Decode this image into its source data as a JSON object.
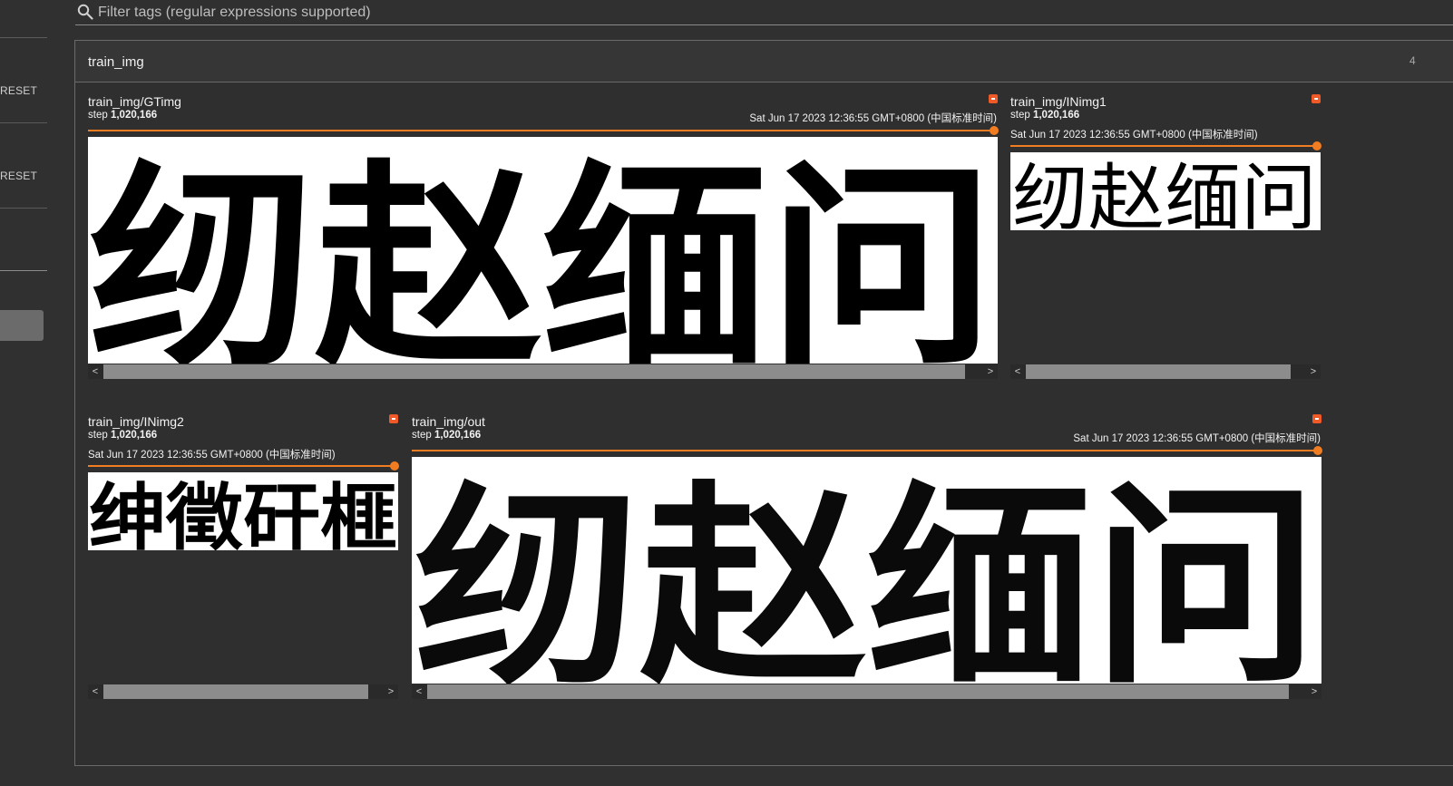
{
  "sidebar": {
    "reset_labels": [
      "RESET",
      "RESET"
    ]
  },
  "filter": {
    "placeholder": "Filter tags (regular expressions supported)",
    "icon": "search-icon"
  },
  "group": {
    "title": "train_img",
    "count": "4"
  },
  "cards": [
    {
      "title": "train_img/GTimg",
      "step_label": "step",
      "step_value": "1,020,166",
      "timestamp": "Sat Jun 17 2023 12:36:55 GMT+0800 (中国标准时间)",
      "image_text": "纫赵缅问"
    },
    {
      "title": "train_img/INimg1",
      "step_label": "step",
      "step_value": "1,020,166",
      "timestamp": "Sat Jun 17 2023 12:36:55 GMT+0800 (中国标准时间)",
      "image_text": "纫赵缅问"
    },
    {
      "title": "train_img/INimg2",
      "step_label": "step",
      "step_value": "1,020,166",
      "timestamp": "Sat Jun 17 2023 12:36:55 GMT+0800 (中国标准时间)",
      "image_text": "绅徵矸榧"
    },
    {
      "title": "train_img/out",
      "step_label": "step",
      "step_value": "1,020,166",
      "timestamp": "Sat Jun 17 2023 12:36:55 GMT+0800 (中国标准时间)",
      "image_text": "纫赵缅问"
    }
  ],
  "colors": {
    "background": "#303030",
    "accent": "#f07d22",
    "pin": "#f05a28"
  }
}
